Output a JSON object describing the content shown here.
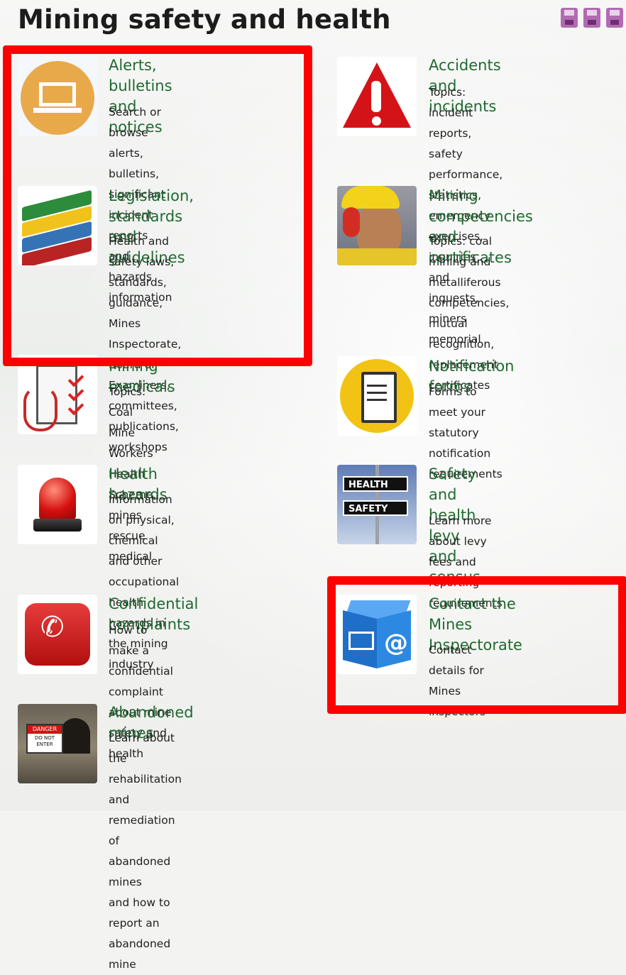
{
  "page": {
    "title": "Mining safety and health"
  },
  "toolbar": {
    "icons": [
      "save-icon",
      "save-icon",
      "save-icon"
    ]
  },
  "items": [
    {
      "title": "Alerts, bulletins and notices",
      "title_lines": [
        "Alerts, bulletins and",
        "notices"
      ],
      "desc_lines": [
        "Search or browse alerts,",
        "bulletins, significant incident",
        "reports and hazards information"
      ],
      "icon": "laptop-icon"
    },
    {
      "title": "Accidents and incidents",
      "title_lines": [
        "Accidents and incidents"
      ],
      "desc_lines": [
        "Topics: incident reports, safety",
        "performance, statistics,",
        "emergency exercises, inquiries",
        "and inquests, miners memorial"
      ],
      "icon": "warning-icon"
    },
    {
      "title": "Legislation, standards and guidelines",
      "title_lines": [
        "Legislation, standards",
        "and guidelines"
      ],
      "desc_lines": [
        "Health and safety laws,",
        "standards, guidance, Mines",
        "Inspectorate, Board of",
        "Examiners, committees,",
        "publications, workshops"
      ],
      "icon": "books-icon"
    },
    {
      "title": "Mining competencies and certificates",
      "title_lines": [
        "Mining competencies",
        "and certificates"
      ],
      "desc_lines": [
        "Topics: coal mining and",
        "metalliferous competencies,",
        "mutual recognition, replacement",
        "certificates"
      ],
      "icon": "worker-icon"
    },
    {
      "title": "Mining medicals",
      "title_lines": [
        "Mining medicals"
      ],
      "desc_lines": [
        "Topics: Coal Mine Workers",
        "Health Scheme, mines rescue",
        "medical"
      ],
      "icon": "medical-clipboard-icon"
    },
    {
      "title": "Notification forms",
      "title_lines": [
        "Notification forms"
      ],
      "desc_lines": [
        "Forms to meet your statutory",
        "notification requirements"
      ],
      "icon": "clipboard-icon"
    },
    {
      "title": "Health hazards",
      "title_lines": [
        "Health hazards"
      ],
      "desc_lines": [
        "Information on physical,",
        "chemical and other occupational",
        "health hazards in the mining",
        "industry"
      ],
      "icon": "siren-icon"
    },
    {
      "title": "Safety and health levy and census",
      "title_lines": [
        "Safety and health levy",
        "and census"
      ],
      "desc_lines": [
        "Learn more about levy fees and",
        "reporting requirements"
      ],
      "icon": "signpost-icon"
    },
    {
      "title": "Confidential complaints",
      "title_lines": [
        "Confidential complaints"
      ],
      "desc_lines": [
        "How to make a confidential",
        "complaint about mine safety and",
        "health"
      ],
      "icon": "phone-icon"
    },
    {
      "title": "Contact the Mines Inspectorate",
      "title_lines": [
        "Contact the Mines",
        "Inspectorate"
      ],
      "desc_lines": [
        "Contact details for Mines",
        "inspectors"
      ],
      "icon": "contact-cube-icon"
    },
    {
      "title": "Abandoned mines",
      "title_lines": [
        "Abandoned mines"
      ],
      "desc_lines": [
        "Learn about the rehabilitation and",
        "remediation of abandoned mines",
        "and how to report an abandoned",
        "mine"
      ],
      "icon": "danger-sign-icon"
    }
  ],
  "sign_texts": [
    "HEALTH",
    "SAFETY"
  ],
  "danger_texts": [
    "DANGER",
    "DO NOT ENTER"
  ],
  "colors": {
    "title": "#1f6a2f",
    "highlight": "#ff0000",
    "icon_purple": "#b26ab3"
  }
}
